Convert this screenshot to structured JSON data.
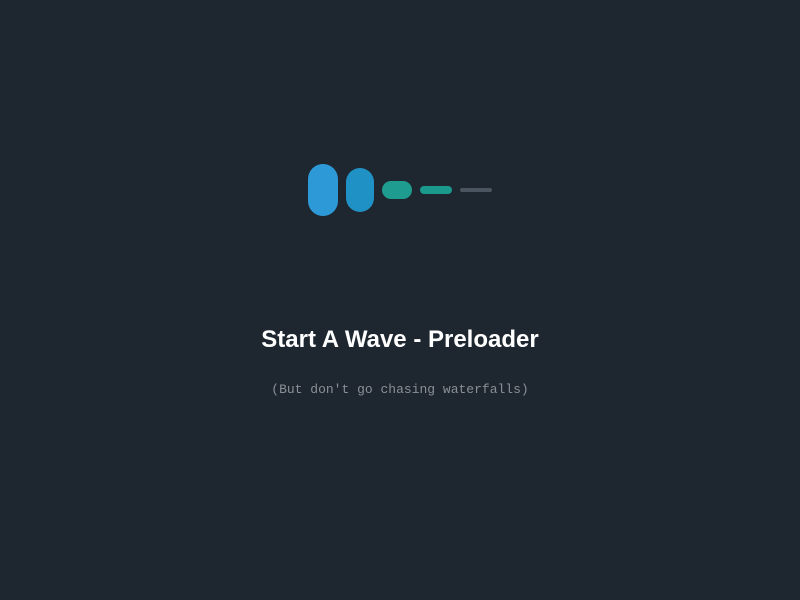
{
  "title": "Start A Wave - Preloader",
  "subtitle": "(But don't go chasing waterfalls)",
  "colors": {
    "background": "#1e2730",
    "dot1": "#2d99d6",
    "dot2": "#2091c4",
    "dot3": "#1e9c8f",
    "dot4": "#1a998c",
    "dot5": "#4a5560",
    "title": "#ffffff",
    "subtitle": "#8a8f95"
  }
}
